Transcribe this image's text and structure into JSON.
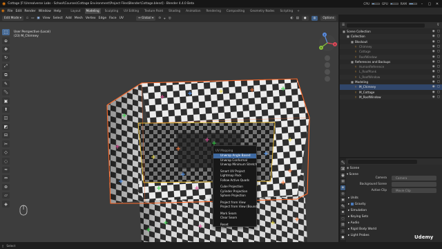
{
  "titlebar": {
    "title": "Cottage [F:\\Unrealverse Labs - School\\Courses\\Cottage Environment\\Project Files\\Blender\\Cottage.blend] - Blender 4.4.0 Beta",
    "cpu_label": "CPU",
    "gpu_label": "GPU",
    "ram_label": "RAM",
    "cpu_level": 0.35,
    "gpu_level": 0.2,
    "ram_level": 0.5
  },
  "menubar": {
    "menus": [
      "File",
      "Edit",
      "Render",
      "Window",
      "Help"
    ],
    "workspaces": [
      "Layout",
      "Modeling",
      "Sculpting",
      "UV Editing",
      "Texture Paint",
      "Shading",
      "Animation",
      "Rendering",
      "Compositing",
      "Geometry Nodes",
      "Scripting"
    ],
    "active_workspace_index": 1
  },
  "viewport_header": {
    "mode": "Edit Mode",
    "menus": [
      "View",
      "Select",
      "Add",
      "Mesh",
      "Vertex",
      "Edge",
      "Face",
      "UV"
    ],
    "orientation": "Global",
    "options_label": "Options"
  },
  "viewport": {
    "view_name": "User Perspective (Local)",
    "object_info": "(23) M_Chimney",
    "gizmo_axes": [
      "X",
      "Y",
      "Z"
    ]
  },
  "context_menu": {
    "title": "UV Mapping",
    "items": [
      "Unwrap Angle Based",
      "Unwrap Conformal",
      "Unwrap Minimum Stretch",
      "Smart UV Project",
      "Lightmap Pack",
      "Follow Active Quads",
      "Cube Projection",
      "Cylinder Projection",
      "Sphere Projection",
      "Project from View",
      "Project from View (Bounds)",
      "Mark Seam",
      "Clear Seam",
      "Reset"
    ],
    "highlighted_index": 0,
    "groups": [
      [
        0,
        1,
        2
      ],
      [
        3,
        4,
        5
      ],
      [
        6,
        7,
        8
      ],
      [
        9,
        10
      ],
      [
        11,
        12
      ],
      [
        13
      ]
    ]
  },
  "outliner": {
    "header": "Scene Collection",
    "rows": [
      {
        "label": "Scene Collection",
        "depth": 0,
        "icon": "collection-icon"
      },
      {
        "label": "Collection",
        "depth": 1,
        "icon": "collection-icon"
      },
      {
        "label": "Blockout",
        "depth": 2,
        "icon": "collection-icon"
      },
      {
        "label": "Chimney",
        "depth": 3,
        "icon": "mesh-icon"
      },
      {
        "label": "Cottage",
        "depth": 3,
        "icon": "mesh-icon"
      },
      {
        "label": "RoofWindow",
        "depth": 3,
        "icon": "mesh-icon"
      },
      {
        "label": "References and Backups",
        "depth": 2,
        "icon": "collection-icon"
      },
      {
        "label": "HumanReference",
        "depth": 3,
        "icon": "mesh-icon"
      },
      {
        "label": "L_RoofPlank",
        "depth": 3,
        "icon": "mesh-icon"
      },
      {
        "label": "L_RoofWindow",
        "depth": 3,
        "icon": "mesh-icon"
      },
      {
        "label": "Modeling",
        "depth": 2,
        "icon": "collection-icon"
      },
      {
        "label": "M_Chimney",
        "depth": 3,
        "icon": "mesh-icon",
        "selected": true
      },
      {
        "label": "M_Cottage",
        "depth": 3,
        "icon": "mesh-icon"
      },
      {
        "label": "M_RoofWindow",
        "depth": 3,
        "icon": "mesh-icon"
      }
    ]
  },
  "properties": {
    "scene_label": "Scene",
    "panels": {
      "scene": "Scene",
      "camera_label": "Camera",
      "camera_value": "Camera",
      "bg_scene_label": "Background Scene",
      "active_clip_label": "Active Clip",
      "active_clip_value": "Movie Clip",
      "units": "Units",
      "gravity": "Gravity",
      "simulation": "Simulation",
      "keying_sets": "Keying Sets",
      "audio": "Audio",
      "rigid_body_world": "Rigid Body World",
      "light_probes": "Light Probes"
    }
  },
  "statusbar": {
    "select": "Select",
    "watermark": "Udemy"
  }
}
